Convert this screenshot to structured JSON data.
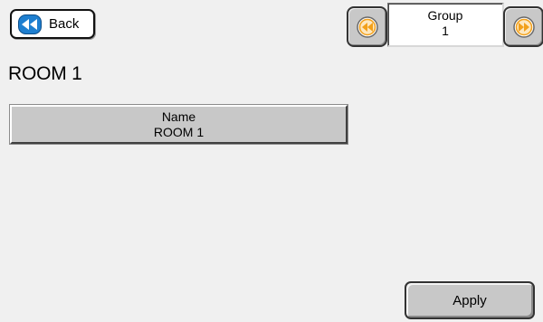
{
  "back_button": {
    "label": "Back",
    "icon": "rewind-icon"
  },
  "page_title": "ROOM 1",
  "group": {
    "label": "Group",
    "value": "1",
    "prev_icon": "rewind-icon",
    "next_icon": "fast-forward-icon"
  },
  "name_field": {
    "label": "Name",
    "value": "ROOM 1"
  },
  "apply_button": {
    "label": "Apply"
  },
  "colors": {
    "background": "#f0f0f0",
    "button_face": "#c8c8c8",
    "icon_blue": "#1e7fd0",
    "icon_orange": "#f2a01a"
  }
}
